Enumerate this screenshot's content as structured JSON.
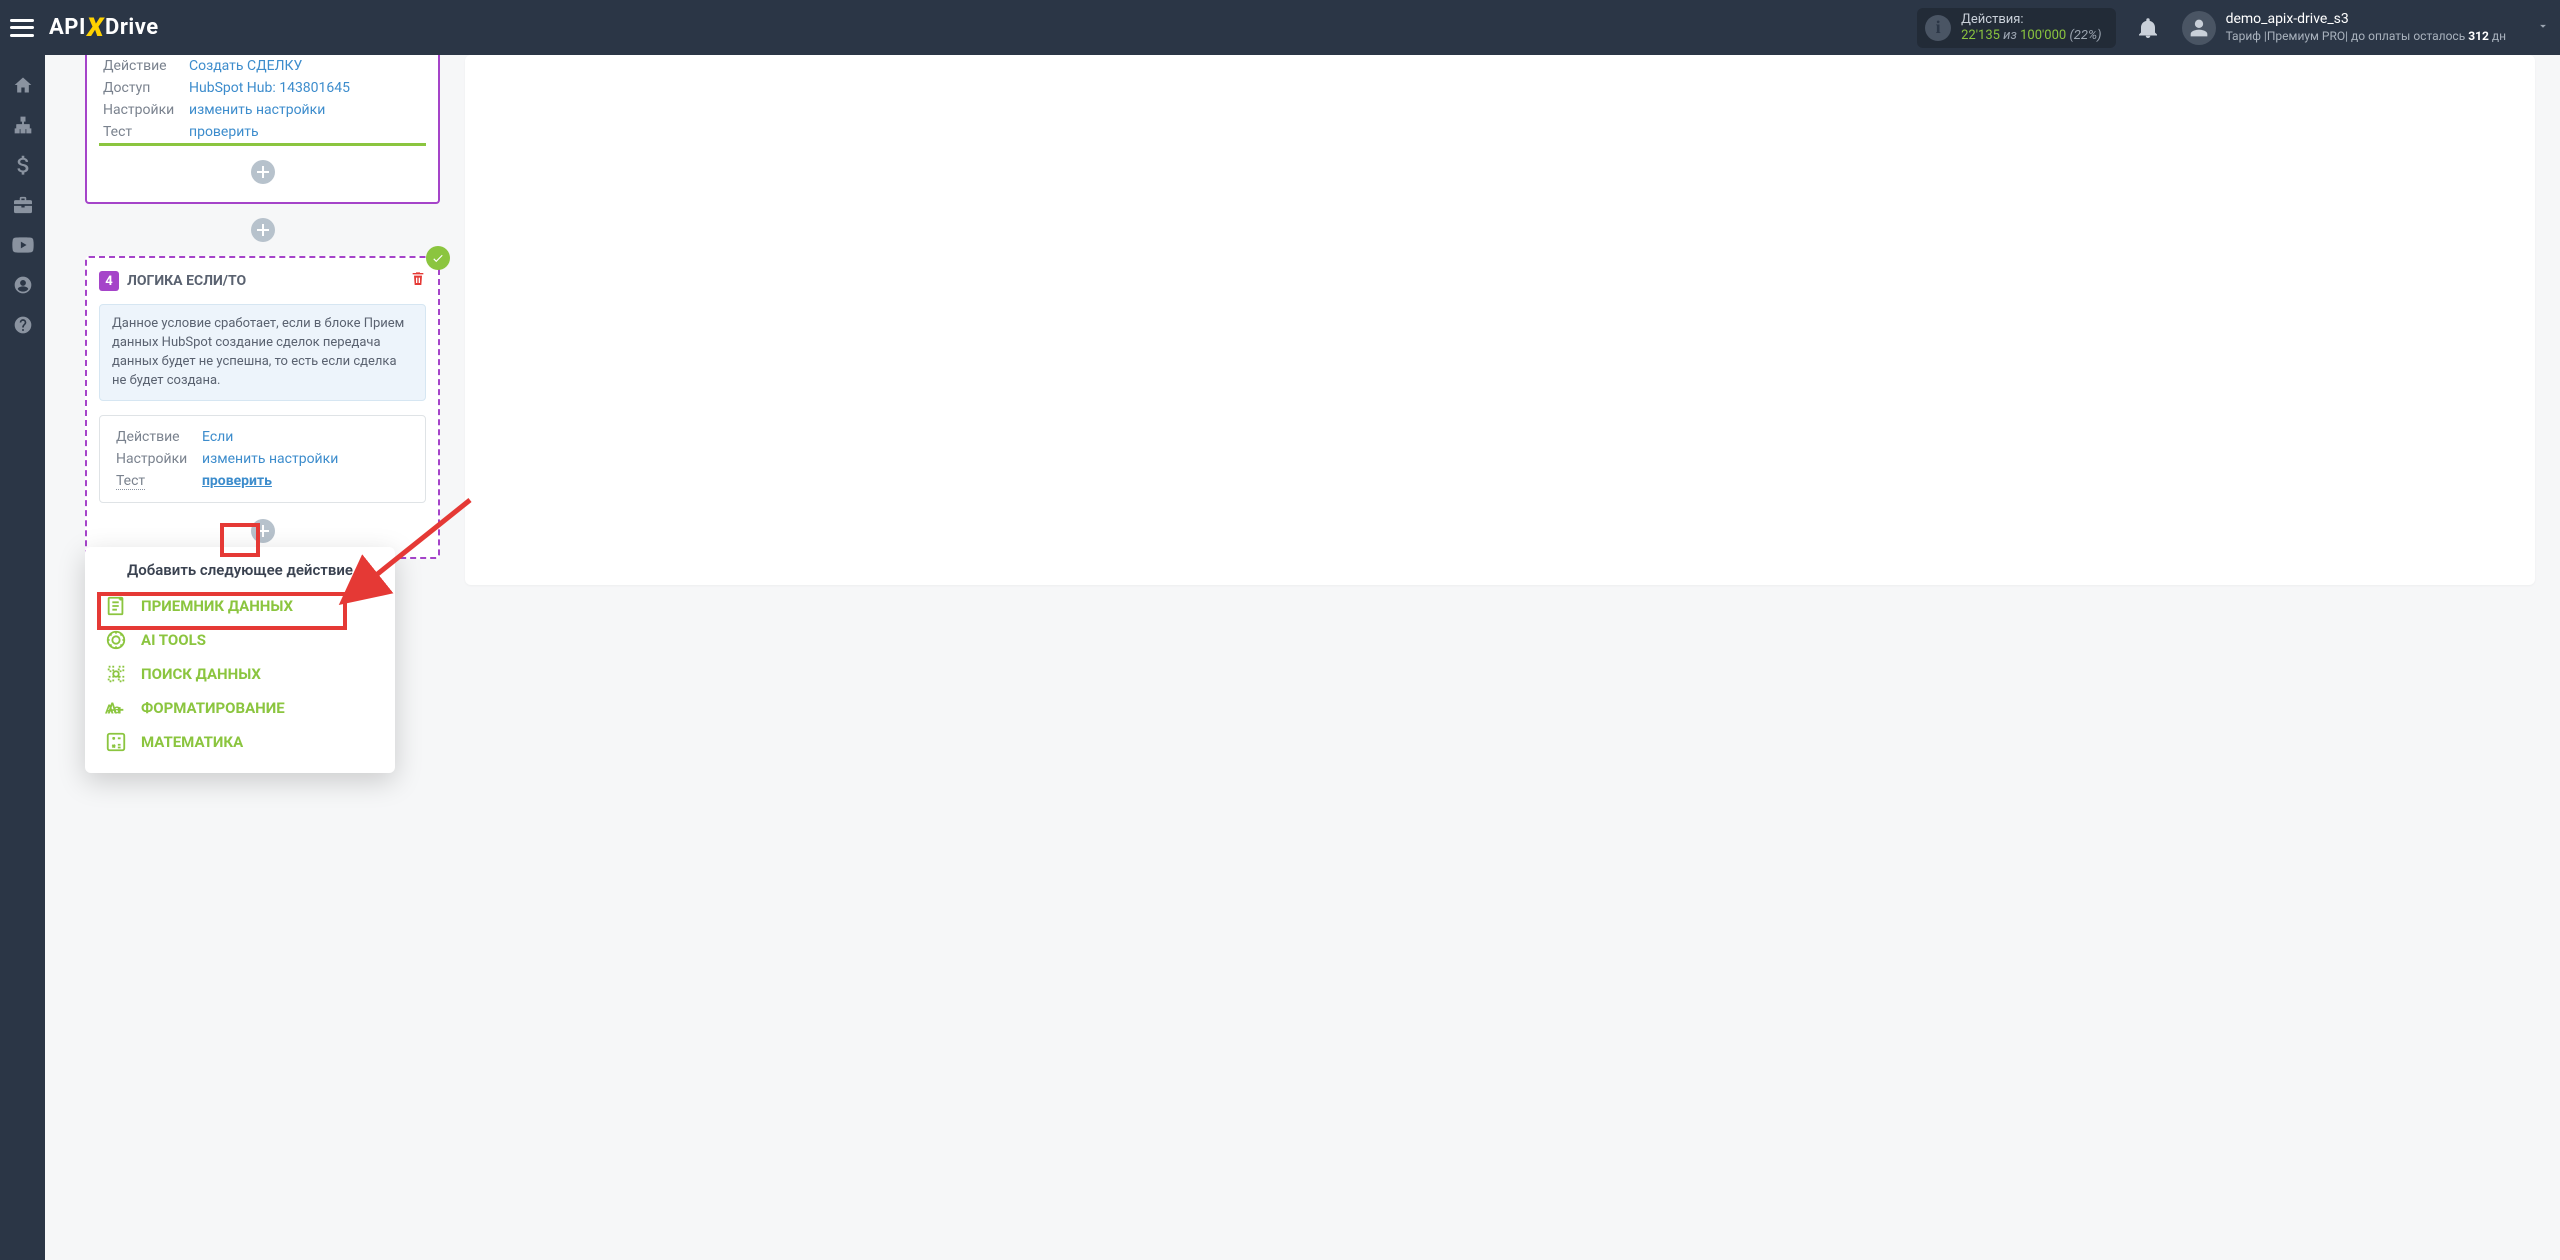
{
  "header": {
    "logo_pre": "API",
    "logo_post": "Drive",
    "actions_label": "Действия:",
    "actions_used": "22'135",
    "actions_sep": "из",
    "actions_total": "100'000",
    "actions_pct": "(22%)",
    "username": "demo_apix-drive_s3",
    "tariff_pre": "Тариф |",
    "tariff_name": "Премиум PRO",
    "tariff_post": "| до оплаты осталось ",
    "tariff_days": "312",
    "tariff_days_suffix": " дн"
  },
  "sidebar_icons": [
    "home",
    "sitemap",
    "dollar",
    "briefcase",
    "youtube",
    "user",
    "question"
  ],
  "block_top": {
    "rows": [
      {
        "k": "Действие",
        "v": "Создать СДЕЛКУ",
        "href": true
      },
      {
        "k": "Доступ",
        "v": "HubSpot Hub: 143801645",
        "href": true
      },
      {
        "k": "Настройки",
        "v": "изменить настройки",
        "href": true
      },
      {
        "k": "Тест",
        "v": "проверить",
        "href": true
      }
    ]
  },
  "logic": {
    "num": "4",
    "title": "ЛОГИКА ЕСЛИ/ТО",
    "note": "Данное условие сработает, если в блоке Прием данных HubSpot создание сделок передача данных будет не успешна, то есть если сделка не будет создана.",
    "rows": [
      {
        "k": "Действие",
        "v": "Если",
        "href": true,
        "style": "plain"
      },
      {
        "k": "Настройки",
        "v": "изменить настройки",
        "href": true,
        "style": "plain"
      },
      {
        "k": "Тест",
        "v": "проверить",
        "href": true,
        "style": "bold",
        "k_dotted": true
      }
    ]
  },
  "menu": {
    "title": "Добавить следующее действие",
    "items": [
      {
        "icon": "receiver",
        "label": "ПРИЕМНИК ДАННЫХ"
      },
      {
        "icon": "ai",
        "label": "AI TOOLS"
      },
      {
        "icon": "search",
        "label": "ПОИСК ДАННЫХ"
      },
      {
        "icon": "format",
        "label": "ФОРМАТИРОВАНИЕ"
      },
      {
        "icon": "math",
        "label": "МАТЕМАТИКА"
      }
    ]
  }
}
